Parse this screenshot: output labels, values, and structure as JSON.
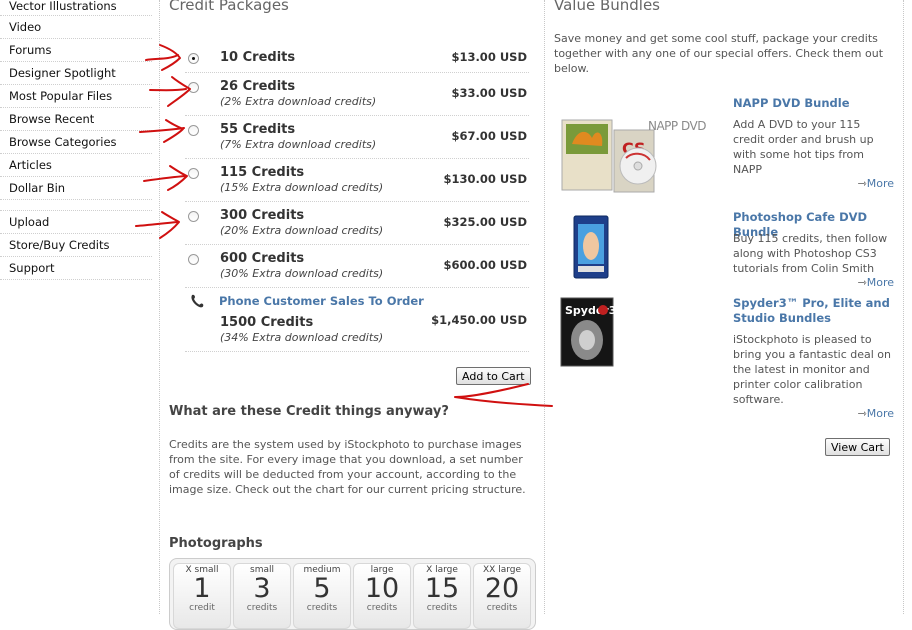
{
  "nav": {
    "items": [
      "Vector Illustrations",
      "Video",
      "Forums",
      "Designer Spotlight",
      "Most Popular Files",
      "Browse Recent",
      "Browse Categories",
      "Articles",
      "Dollar Bin"
    ],
    "items2": [
      "Upload",
      "Store/Buy Credits",
      "Support"
    ]
  },
  "credits": {
    "title": "Credit Packages",
    "packages": [
      {
        "name": "10 Credits",
        "extra": "",
        "price": "$13.00 USD"
      },
      {
        "name": "26 Credits",
        "extra": "(2% Extra download credits)",
        "price": "$33.00 USD"
      },
      {
        "name": "55 Credits",
        "extra": "(7% Extra download credits)",
        "price": "$67.00 USD"
      },
      {
        "name": "115 Credits",
        "extra": "(15% Extra download credits)",
        "price": "$130.00 USD"
      },
      {
        "name": "300 Credits",
        "extra": "(20% Extra download credits)",
        "price": "$325.00 USD"
      },
      {
        "name": "600 Credits",
        "extra": "(30% Extra download credits)",
        "price": "$600.00 USD"
      }
    ],
    "phone_link": "Phone Customer Sales To Order",
    "phone_package": {
      "name": "1500 Credits",
      "extra": "(34% Extra download credits)",
      "price": "$1,450.00 USD"
    },
    "add_to_cart": "Add to Cart",
    "faq_title": "What are these Credit things anyway?",
    "faq_text": "Credits are the system used by iStockphoto to purchase images from the site. For every image that you download, a set number of credits will be deducted from your account, according to the image size. Check out the chart for our current pricing structure.",
    "photographs_title": "Photographs",
    "pricing": [
      {
        "size": "X small",
        "credits": "1",
        "unit": "credit"
      },
      {
        "size": "small",
        "credits": "3",
        "unit": "credits"
      },
      {
        "size": "medium",
        "credits": "5",
        "unit": "credits"
      },
      {
        "size": "large",
        "credits": "10",
        "unit": "credits"
      },
      {
        "size": "X large",
        "credits": "15",
        "unit": "credits"
      },
      {
        "size": "XX large",
        "credits": "20",
        "unit": "credits"
      }
    ]
  },
  "bundles": {
    "title": "Value Bundles",
    "intro": "Save money and get some cool stuff, package your credits together with any one of our special offers. Check them out below.",
    "items": [
      {
        "title": "NAPP DVD Bundle",
        "desc": "Add A DVD to your 115 credit order and brush up with some hot tips from NAPP",
        "more": "More",
        "image_text": "NAPP DVD BUNDLES",
        "image_logo": "CS"
      },
      {
        "title": "Photoshop Cafe DVD Bundle",
        "desc": "Buy 115 credits, then follow along with Photoshop CS3 tutorials from Colin Smith",
        "more": "More"
      },
      {
        "title": "Spyder3™ Pro, Elite and Studio Bundles",
        "desc": "iStockphoto is pleased to bring you a fantastic deal on the latest in monitor and printer color calibration software.",
        "more": "More",
        "image_text": "Spyder3"
      }
    ],
    "view_cart": "View Cart"
  },
  "colors": {
    "link": "#4a77a8",
    "annotation": "#d01010"
  }
}
